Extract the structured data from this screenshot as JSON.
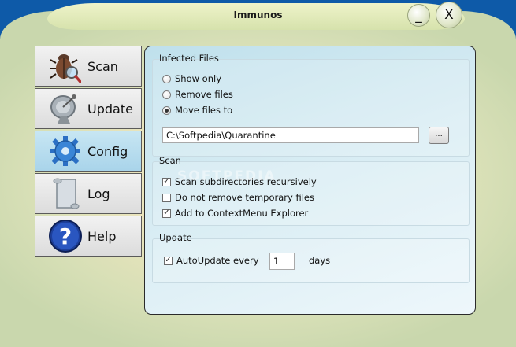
{
  "window": {
    "title": "Immunos",
    "minimize_label": "_",
    "close_label": "X"
  },
  "nav": {
    "items": [
      {
        "label": "Scan",
        "icon": "bug-magnifier-icon"
      },
      {
        "label": "Update",
        "icon": "satellite-dish-icon"
      },
      {
        "label": "Config",
        "icon": "gear-icon"
      },
      {
        "label": "Log",
        "icon": "scroll-icon"
      },
      {
        "label": "Help",
        "icon": "question-icon"
      }
    ],
    "active": "Config"
  },
  "infected_files": {
    "title": "Infected Files",
    "options": [
      {
        "label": "Show only",
        "checked": false
      },
      {
        "label": "Remove files",
        "checked": false
      },
      {
        "label": "Move files to",
        "checked": true
      }
    ],
    "path_value": "C:\\Softpedia\\Quarantine",
    "browse_label": "..."
  },
  "scan": {
    "title": "Scan",
    "options": [
      {
        "label": "Scan subdirectories recursively",
        "checked": true
      },
      {
        "label": "Do not remove temporary files",
        "checked": false
      },
      {
        "label": "Add to ContextMenu Explorer",
        "checked": true
      }
    ]
  },
  "update": {
    "title": "Update",
    "auto_label": "AutoUpdate every",
    "auto_checked": true,
    "days_value": "1",
    "days_label": "days"
  },
  "watermark": "SOFTPEDIA",
  "colors": {
    "outer_blue": "#0e5aa8",
    "shell": "#e9e4bc",
    "active_nav": "#a9d4ea",
    "panel": "#d7ecf3"
  }
}
